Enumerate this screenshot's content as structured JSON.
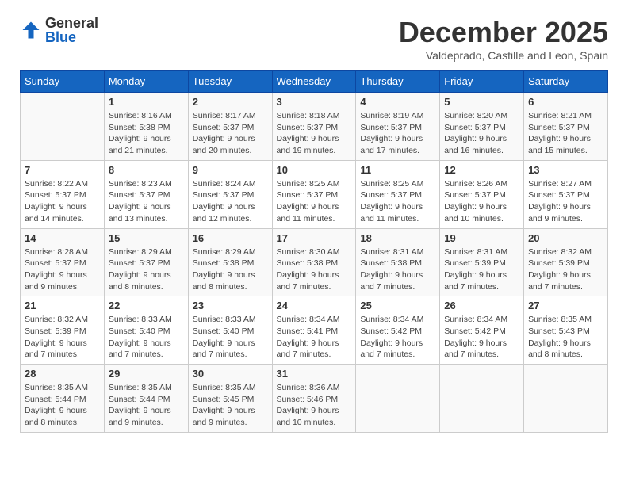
{
  "logo": {
    "general": "General",
    "blue": "Blue"
  },
  "title": "December 2025",
  "subtitle": "Valdeprado, Castille and Leon, Spain",
  "days_of_week": [
    "Sunday",
    "Monday",
    "Tuesday",
    "Wednesday",
    "Thursday",
    "Friday",
    "Saturday"
  ],
  "weeks": [
    [
      {
        "day": "",
        "info": ""
      },
      {
        "day": "1",
        "info": "Sunrise: 8:16 AM\nSunset: 5:38 PM\nDaylight: 9 hours\nand 21 minutes."
      },
      {
        "day": "2",
        "info": "Sunrise: 8:17 AM\nSunset: 5:37 PM\nDaylight: 9 hours\nand 20 minutes."
      },
      {
        "day": "3",
        "info": "Sunrise: 8:18 AM\nSunset: 5:37 PM\nDaylight: 9 hours\nand 19 minutes."
      },
      {
        "day": "4",
        "info": "Sunrise: 8:19 AM\nSunset: 5:37 PM\nDaylight: 9 hours\nand 17 minutes."
      },
      {
        "day": "5",
        "info": "Sunrise: 8:20 AM\nSunset: 5:37 PM\nDaylight: 9 hours\nand 16 minutes."
      },
      {
        "day": "6",
        "info": "Sunrise: 8:21 AM\nSunset: 5:37 PM\nDaylight: 9 hours\nand 15 minutes."
      }
    ],
    [
      {
        "day": "7",
        "info": "Sunrise: 8:22 AM\nSunset: 5:37 PM\nDaylight: 9 hours\nand 14 minutes."
      },
      {
        "day": "8",
        "info": "Sunrise: 8:23 AM\nSunset: 5:37 PM\nDaylight: 9 hours\nand 13 minutes."
      },
      {
        "day": "9",
        "info": "Sunrise: 8:24 AM\nSunset: 5:37 PM\nDaylight: 9 hours\nand 12 minutes."
      },
      {
        "day": "10",
        "info": "Sunrise: 8:25 AM\nSunset: 5:37 PM\nDaylight: 9 hours\nand 11 minutes."
      },
      {
        "day": "11",
        "info": "Sunrise: 8:25 AM\nSunset: 5:37 PM\nDaylight: 9 hours\nand 11 minutes."
      },
      {
        "day": "12",
        "info": "Sunrise: 8:26 AM\nSunset: 5:37 PM\nDaylight: 9 hours\nand 10 minutes."
      },
      {
        "day": "13",
        "info": "Sunrise: 8:27 AM\nSunset: 5:37 PM\nDaylight: 9 hours\nand 9 minutes."
      }
    ],
    [
      {
        "day": "14",
        "info": "Sunrise: 8:28 AM\nSunset: 5:37 PM\nDaylight: 9 hours\nand 9 minutes."
      },
      {
        "day": "15",
        "info": "Sunrise: 8:29 AM\nSunset: 5:37 PM\nDaylight: 9 hours\nand 8 minutes."
      },
      {
        "day": "16",
        "info": "Sunrise: 8:29 AM\nSunset: 5:38 PM\nDaylight: 9 hours\nand 8 minutes."
      },
      {
        "day": "17",
        "info": "Sunrise: 8:30 AM\nSunset: 5:38 PM\nDaylight: 9 hours\nand 7 minutes."
      },
      {
        "day": "18",
        "info": "Sunrise: 8:31 AM\nSunset: 5:38 PM\nDaylight: 9 hours\nand 7 minutes."
      },
      {
        "day": "19",
        "info": "Sunrise: 8:31 AM\nSunset: 5:39 PM\nDaylight: 9 hours\nand 7 minutes."
      },
      {
        "day": "20",
        "info": "Sunrise: 8:32 AM\nSunset: 5:39 PM\nDaylight: 9 hours\nand 7 minutes."
      }
    ],
    [
      {
        "day": "21",
        "info": "Sunrise: 8:32 AM\nSunset: 5:39 PM\nDaylight: 9 hours\nand 7 minutes."
      },
      {
        "day": "22",
        "info": "Sunrise: 8:33 AM\nSunset: 5:40 PM\nDaylight: 9 hours\nand 7 minutes."
      },
      {
        "day": "23",
        "info": "Sunrise: 8:33 AM\nSunset: 5:40 PM\nDaylight: 9 hours\nand 7 minutes."
      },
      {
        "day": "24",
        "info": "Sunrise: 8:34 AM\nSunset: 5:41 PM\nDaylight: 9 hours\nand 7 minutes."
      },
      {
        "day": "25",
        "info": "Sunrise: 8:34 AM\nSunset: 5:42 PM\nDaylight: 9 hours\nand 7 minutes."
      },
      {
        "day": "26",
        "info": "Sunrise: 8:34 AM\nSunset: 5:42 PM\nDaylight: 9 hours\nand 7 minutes."
      },
      {
        "day": "27",
        "info": "Sunrise: 8:35 AM\nSunset: 5:43 PM\nDaylight: 9 hours\nand 8 minutes."
      }
    ],
    [
      {
        "day": "28",
        "info": "Sunrise: 8:35 AM\nSunset: 5:44 PM\nDaylight: 9 hours\nand 8 minutes."
      },
      {
        "day": "29",
        "info": "Sunrise: 8:35 AM\nSunset: 5:44 PM\nDaylight: 9 hours\nand 9 minutes."
      },
      {
        "day": "30",
        "info": "Sunrise: 8:35 AM\nSunset: 5:45 PM\nDaylight: 9 hours\nand 9 minutes."
      },
      {
        "day": "31",
        "info": "Sunrise: 8:36 AM\nSunset: 5:46 PM\nDaylight: 9 hours\nand 10 minutes."
      },
      {
        "day": "",
        "info": ""
      },
      {
        "day": "",
        "info": ""
      },
      {
        "day": "",
        "info": ""
      }
    ]
  ]
}
